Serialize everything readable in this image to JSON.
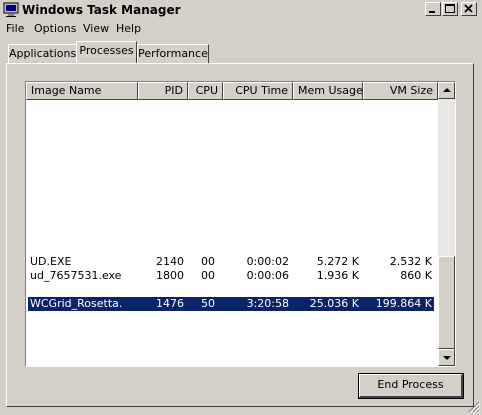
{
  "window": {
    "title": "Windows Task Manager",
    "controls": {
      "minimize": "_",
      "maximize": "□",
      "close": "✕"
    }
  },
  "menu": {
    "items": [
      "File",
      "Options",
      "View",
      "Help"
    ]
  },
  "tabs": [
    {
      "label": "Applications",
      "active": false
    },
    {
      "label": "Processes",
      "active": true
    },
    {
      "label": "Performance",
      "active": false
    }
  ],
  "process_list": {
    "columns": [
      "Image Name",
      "PID",
      "CPU",
      "CPU Time",
      "Mem Usage",
      "VM Size"
    ],
    "rows": [
      {
        "image": "UD.EXE",
        "pid": "2140",
        "cpu": "00",
        "cpu_time": "0:00:02",
        "mem": "5.272 K",
        "vm": "2.532 K",
        "selected": false
      },
      {
        "image": "ud_7657531.exe",
        "pid": "1800",
        "cpu": "00",
        "cpu_time": "0:00:06",
        "mem": "1.936 K",
        "vm": "860 K",
        "selected": false
      },
      {
        "image": "WCGrid_Rosetta.",
        "pid": "1476",
        "cpu": "50",
        "cpu_time": "3:20:58",
        "mem": "25.036 K",
        "vm": "199.864 K",
        "selected": true
      }
    ]
  },
  "buttons": {
    "end_process": "End Process"
  },
  "colors": {
    "face": "#d4d0c8",
    "selection": "#0a246a"
  }
}
